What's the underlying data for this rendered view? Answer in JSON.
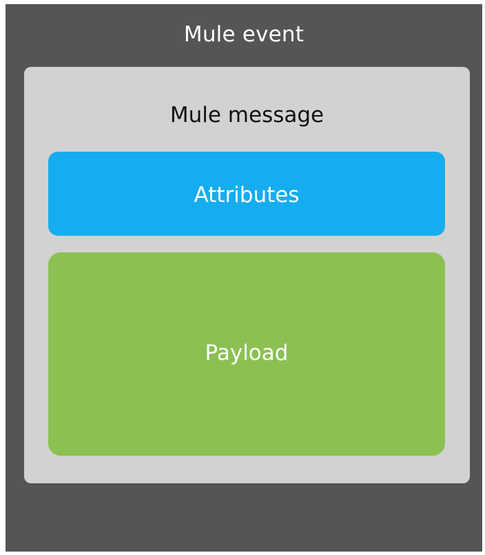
{
  "diagram": {
    "event": {
      "title": "Mule event",
      "background_color": "#555555"
    },
    "message": {
      "title": "Mule message",
      "background_color": "#d3d2d2",
      "parts": [
        {
          "label": "Attributes",
          "color": "#16adf0"
        },
        {
          "label": "Payload",
          "color": "#8bc152"
        }
      ]
    }
  }
}
